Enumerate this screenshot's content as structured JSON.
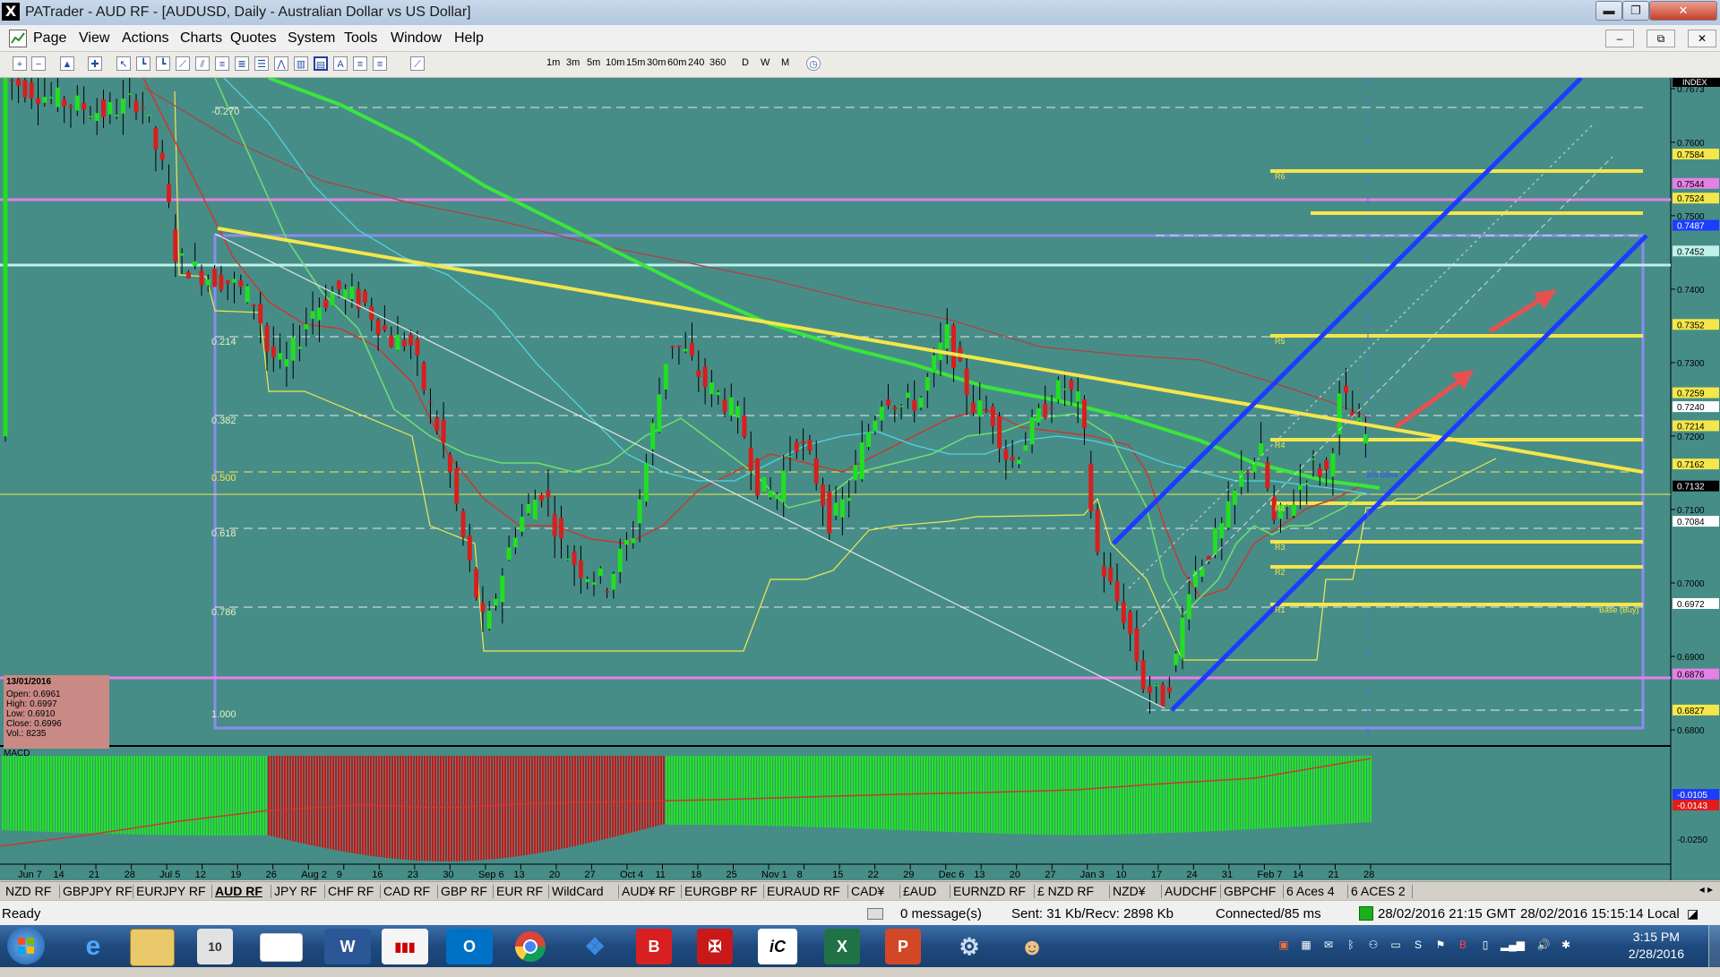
{
  "window": {
    "app_icon": "X",
    "title": "PATrader - AUD RF - [AUDUSD, Daily - Australian Dollar vs US Dollar]",
    "min_label": "▬",
    "max_label": "❐",
    "close_label": "✕"
  },
  "menu": {
    "items": [
      "Page",
      "View",
      "Actions",
      "Charts",
      "Quotes",
      "System",
      "Tools",
      "Window",
      "Help"
    ],
    "mdi_min": "–",
    "mdi_restore": "⧉",
    "mdi_close": "✕"
  },
  "toolbar": {
    "timeframes": [
      "1m",
      "3m",
      "5m",
      "10m",
      "15m",
      "30m",
      "60m",
      "240",
      "360",
      "D",
      "W",
      "M"
    ],
    "tools": [
      "zoom-in-icon",
      "zoom-out-icon",
      "chart-icon",
      "crosshair-icon",
      "cursor-icon",
      "hline-icon",
      "line-icon",
      "trendline-icon",
      "channel-icon",
      "fib-icon",
      "rect-icon",
      "text-icon",
      "fan-icon",
      "grid-icon",
      "gauge-icon",
      "arrow-icon",
      "text-tool-icon"
    ]
  },
  "chart": {
    "index_label": "INDEX",
    "price_axis": [
      "0.7673",
      "0.7600",
      "0.7500",
      "0.7400",
      "0.7300",
      "0.7200",
      "0.7100",
      "0.7000",
      "0.6900",
      "0.6800"
    ],
    "price_tags": [
      {
        "v": "0.7584",
        "color": "#f5e64a"
      },
      {
        "v": "0.7524",
        "color": "#f5e64a"
      },
      {
        "v": "0.7544",
        "color": "#e580e5"
      },
      {
        "v": "0.7487",
        "color": "#1c3cff"
      },
      {
        "v": "0.7452",
        "color": "#bff0ea"
      },
      {
        "v": "0.7352",
        "color": "#f5e64a"
      },
      {
        "v": "0.7259",
        "color": "#f5e64a"
      },
      {
        "v": "0.7240",
        "color": "#ffffff"
      },
      {
        "v": "0.7214",
        "color": "#f5e64a"
      },
      {
        "v": "0.7162",
        "color": "#f5e64a"
      },
      {
        "v": "0.7132",
        "color": "#000000"
      },
      {
        "v": "0.7084",
        "color": "#ffffff"
      },
      {
        "v": "0.6972",
        "color": "#ffffff"
      },
      {
        "v": "0.6876",
        "color": "#e580e5"
      },
      {
        "v": "0.6827",
        "color": "#f5e64a"
      }
    ],
    "fib_labels": [
      "-0.270",
      "0.214",
      "0.382",
      "0.500",
      "0.618",
      "0.786",
      "1.000"
    ],
    "level_labels": [
      "R6",
      "R5",
      "R4",
      "R4",
      "R3",
      "R2",
      "R1",
      "3rd Base",
      "Base (Buy)"
    ],
    "date_axis": [
      "Jun 7",
      "14",
      "21",
      "28",
      "Jul 5",
      "12",
      "19",
      "26",
      "Aug 2",
      "9",
      "16",
      "23",
      "30",
      "Sep 6",
      "13",
      "20",
      "27",
      "Oct 4",
      "11",
      "18",
      "25",
      "Nov 1",
      "8",
      "15",
      "22",
      "29",
      "Dec 6",
      "13",
      "20",
      "27",
      "Jan 3",
      "10",
      "17",
      "24",
      "31",
      "Feb 7",
      "14",
      "21",
      "28"
    ],
    "macd_label": "MACD",
    "macd_axis": [
      "-0.0250"
    ],
    "macd_tags": [
      {
        "v": "-0.0105",
        "color": "#1c3cff"
      },
      {
        "v": "-0.0143",
        "color": "#e31b1b"
      }
    ],
    "info": {
      "date": "13/01/2016",
      "open": "Open: 0.6961",
      "high": "High: 0.6997",
      "low": "Low: 0.6910",
      "close": "Close: 0.6996",
      "vol": "Vol.: 8235"
    }
  },
  "tabs": [
    "NZD RF",
    "GBPJPY RF",
    "EURJPY RF",
    "AUD RF",
    "JPY RF",
    "CHF RF",
    "CAD RF",
    "GBP RF",
    "EUR RF",
    "WildCard",
    "AUD¥ RF",
    "EURGBP RF",
    "EURAUD RF",
    "CAD¥",
    "£AUD",
    "EURNZD RF",
    "£ NZD RF",
    "NZD¥",
    "AUDCHF",
    "GBPCHF",
    "6 Aces 4",
    "6 ACES 2"
  ],
  "active_tab": "AUD RF",
  "status": {
    "ready": "Ready",
    "messages": "0 message(s)",
    "traffic": "Sent: 31 Kb/Recv: 2898 Kb",
    "connection": "Connected/85 ms",
    "gmt_time": "28/02/2016 21:15 GMT",
    "local_time": "28/02/2016 15:15:14 Local"
  },
  "taskbar": {
    "time": "3:15 PM",
    "date": "2/28/2016",
    "apps": [
      "start-orb",
      "internet-explorer",
      "file-explorer",
      "calendar",
      "blank-window",
      "word",
      "patrader",
      "outlook",
      "chrome",
      "dropbox",
      "b-app",
      "phoenix-app",
      "ic-app",
      "excel",
      "powerpoint",
      "tools-app",
      "people-app"
    ]
  }
}
